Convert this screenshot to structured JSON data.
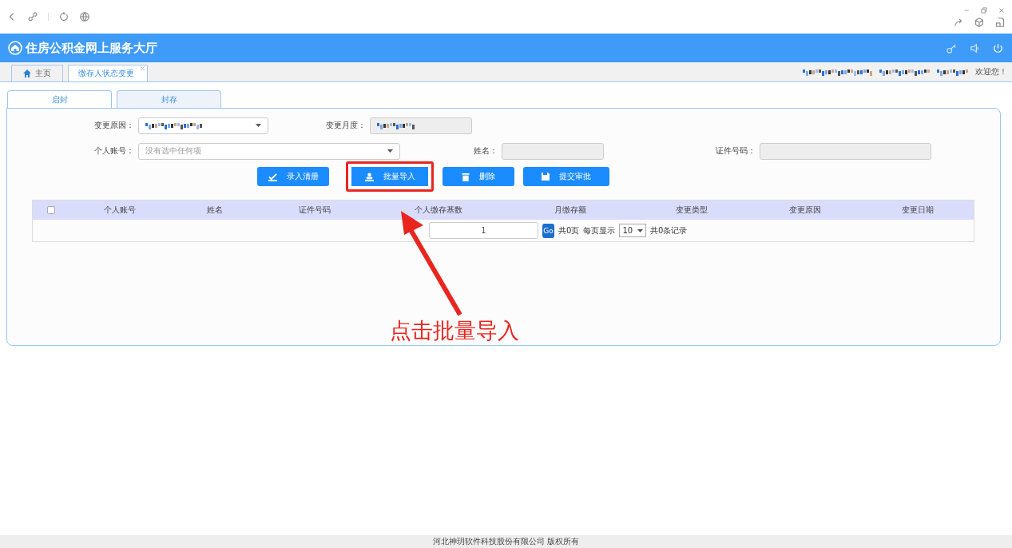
{
  "header": {
    "title": "住房公积金网上服务大厅"
  },
  "nav_tabs": [
    {
      "label": "主页",
      "kind": "home",
      "selected": false
    },
    {
      "label": "缴存人状态变更",
      "kind": "closable",
      "selected": true
    }
  ],
  "user_bar": {
    "masked": true,
    "greeting": "欢迎您！"
  },
  "sub_tabs": [
    {
      "label": "启封",
      "selected": true
    },
    {
      "label": "封存",
      "selected": false
    }
  ],
  "form_rows": [
    [
      {
        "label": "变更原因：",
        "kind": "select",
        "masked": true
      },
      {
        "label": "变更月度：",
        "kind": "readonly",
        "masked": true
      }
    ],
    [
      {
        "label": "个人账号：",
        "kind": "select",
        "placeholder": "没有选中任何项",
        "masked": false
      },
      {
        "label": "姓名：",
        "kind": "readonly",
        "masked": false
      },
      {
        "label": "证件号码：",
        "kind": "readonly-wide",
        "masked": false
      }
    ]
  ],
  "buttons": [
    {
      "label": "录入清册",
      "highlighted": false
    },
    {
      "label": "批量导入",
      "highlighted": true
    },
    {
      "label": "删除",
      "highlighted": false
    },
    {
      "label": "提交审批",
      "highlighted": false
    }
  ],
  "table": {
    "select_all_checked": false,
    "columns": [
      "个人账号",
      "姓名",
      "证件号码",
      "个人缴存基数",
      "月缴存额",
      "变更类型",
      "变更原因",
      "变更日期"
    ]
  },
  "pager": {
    "page": "1",
    "go": "Go",
    "total_pages": "共0页",
    "per_page_label": "每页显示",
    "per_page": "10",
    "records": "共0条记录"
  },
  "annotation": {
    "text": "点击批量导入"
  },
  "footer": "河北神玥软件科技股份有限公司 版权所有"
}
